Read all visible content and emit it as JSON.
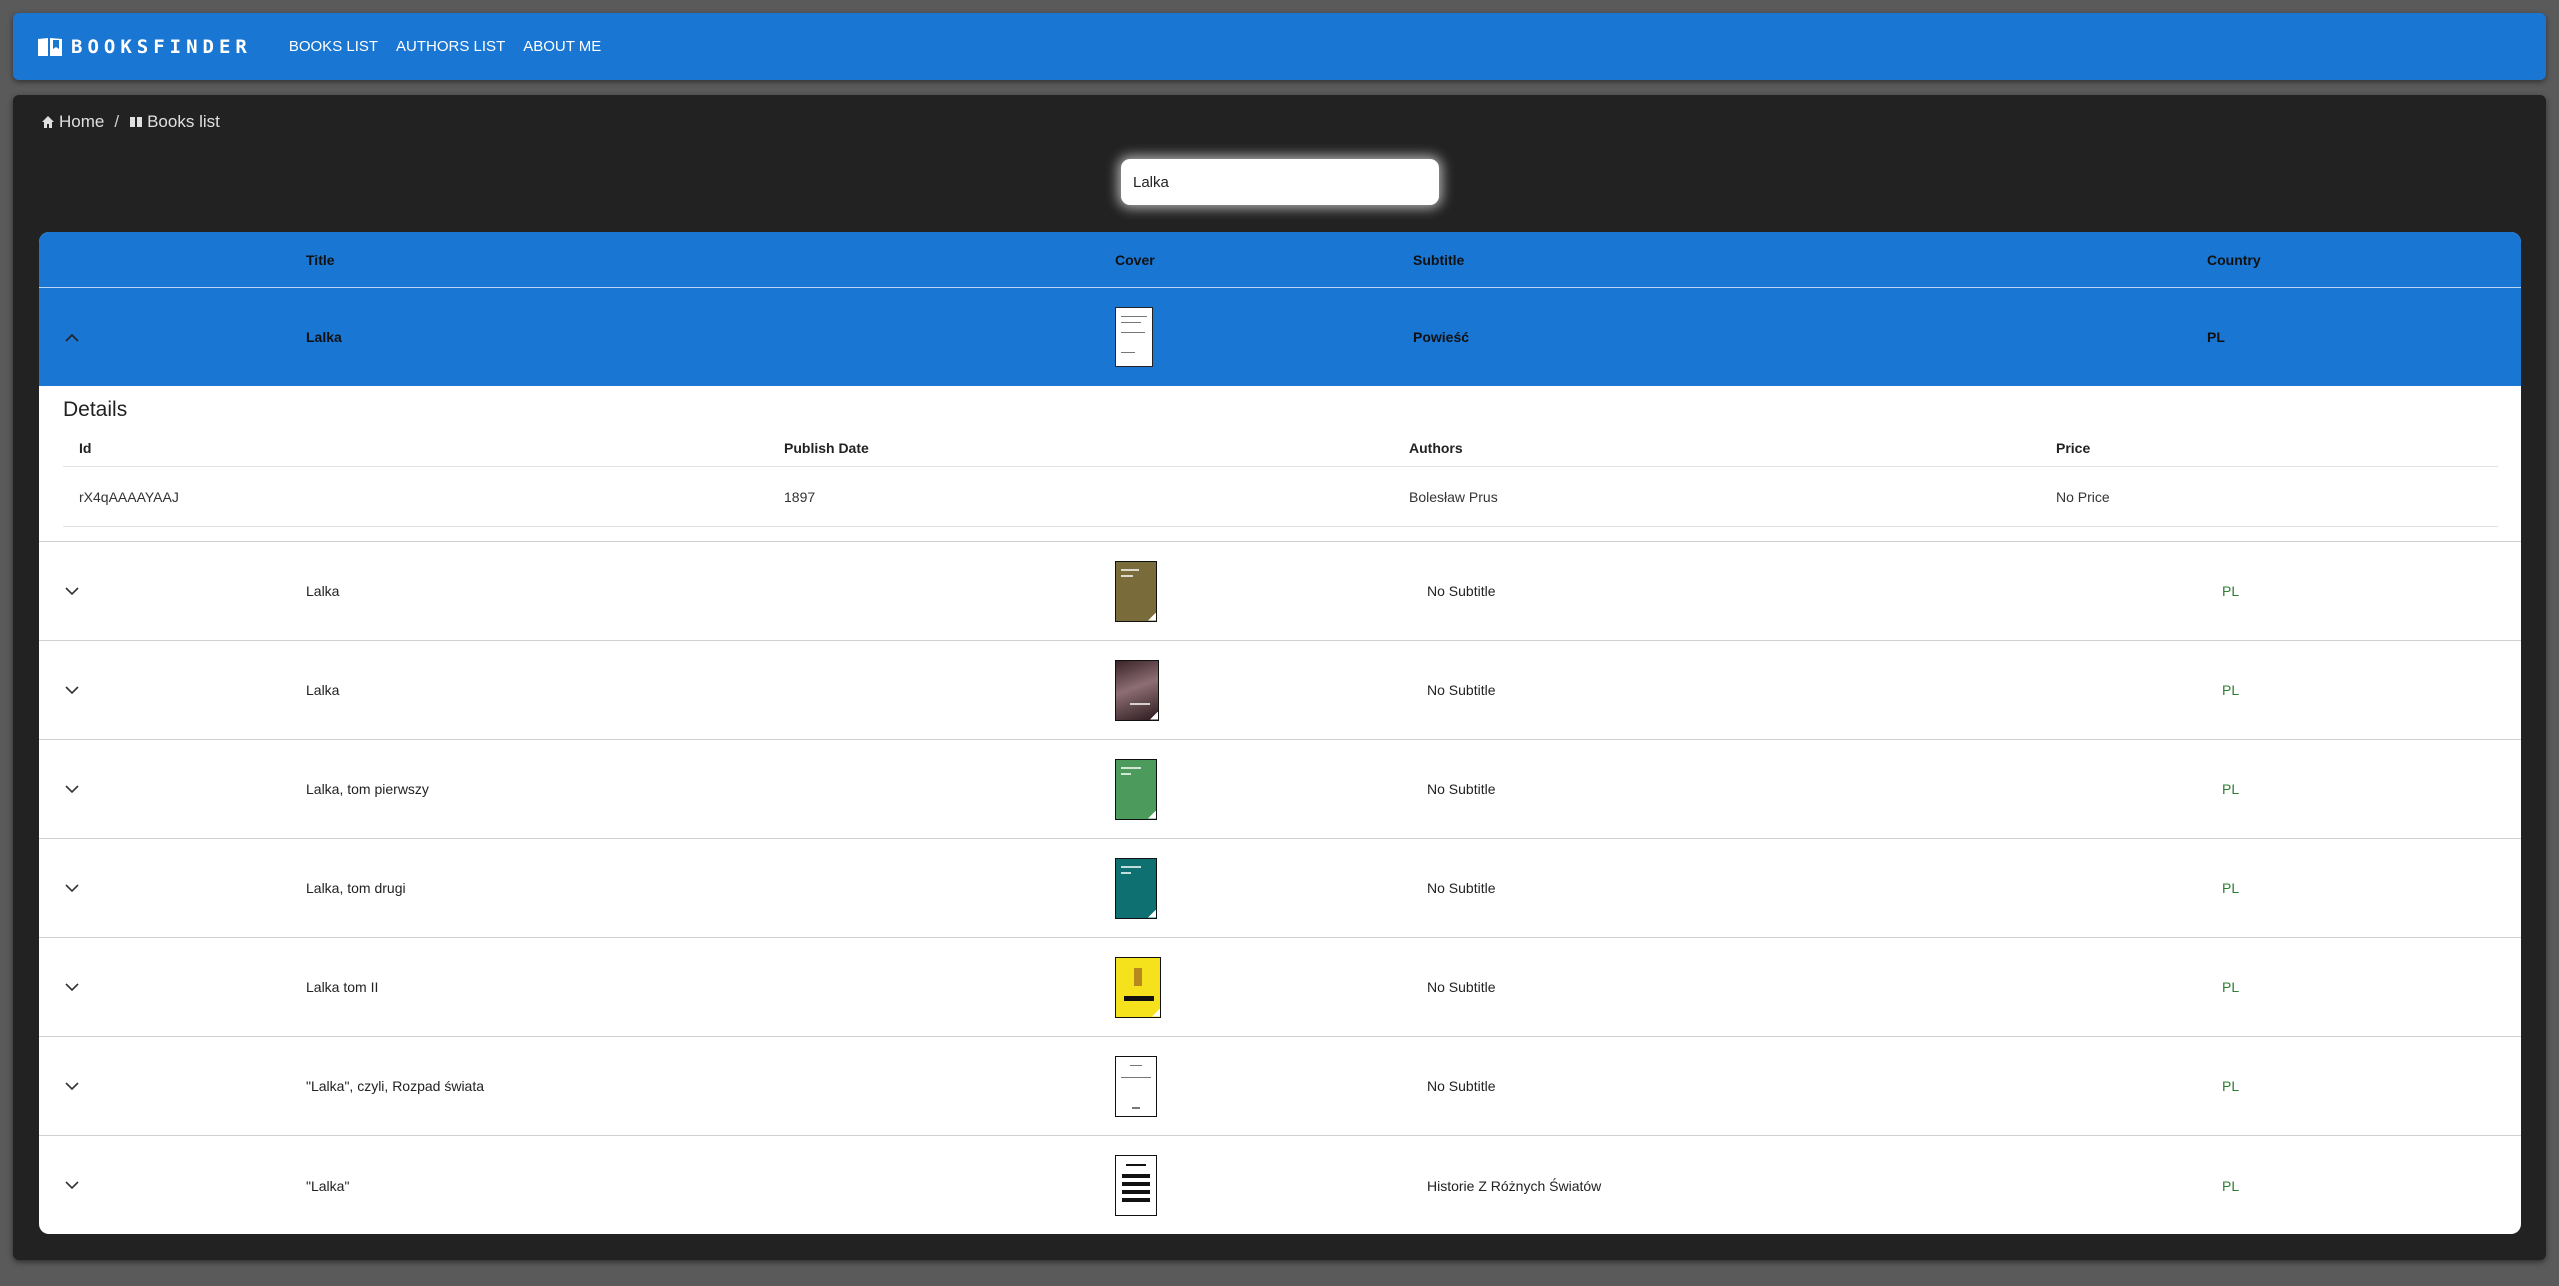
{
  "brand": {
    "name": "BOOKSFINDER",
    "icon": "book-open-icon"
  },
  "nav": {
    "items": [
      "BOOKS LIST",
      "AUTHORS LIST",
      "ABOUT ME"
    ]
  },
  "breadcrumb": {
    "home": "Home",
    "current": "Books list"
  },
  "search": {
    "value": "Lalka"
  },
  "table": {
    "headers": {
      "title": "Title",
      "cover": "Cover",
      "subtitle": "Subtitle",
      "country": "Country"
    },
    "selected": {
      "title": "Lalka",
      "subtitle": "Powieść",
      "country": "PL"
    },
    "details": {
      "title": "Details",
      "headers": {
        "id": "Id",
        "publish_date": "Publish Date",
        "authors": "Authors",
        "price": "Price"
      },
      "values": {
        "id": "rX4qAAAAYAAJ",
        "publish_date": "1897",
        "authors": "Bolesław Prus",
        "price": "No Price"
      }
    },
    "rows": [
      {
        "title": "Lalka",
        "subtitle": "No Subtitle",
        "country": "PL"
      },
      {
        "title": "Lalka",
        "subtitle": "No Subtitle",
        "country": "PL"
      },
      {
        "title": "Lalka, tom pierwszy",
        "subtitle": "No Subtitle",
        "country": "PL"
      },
      {
        "title": "Lalka, tom drugi",
        "subtitle": "No Subtitle",
        "country": "PL"
      },
      {
        "title": "Lalka tom II",
        "subtitle": "No Subtitle",
        "country": "PL"
      },
      {
        "title": "\"Lalka\", czyli, Rozpad świata",
        "subtitle": "No Subtitle",
        "country": "PL"
      },
      {
        "title": "\"Lalka\"",
        "subtitle": "Historie Z Różnych Światów",
        "country": "PL"
      }
    ]
  },
  "colors": {
    "primary": "#1976d2",
    "background": "#222222",
    "country_text": "#2e7d32"
  }
}
